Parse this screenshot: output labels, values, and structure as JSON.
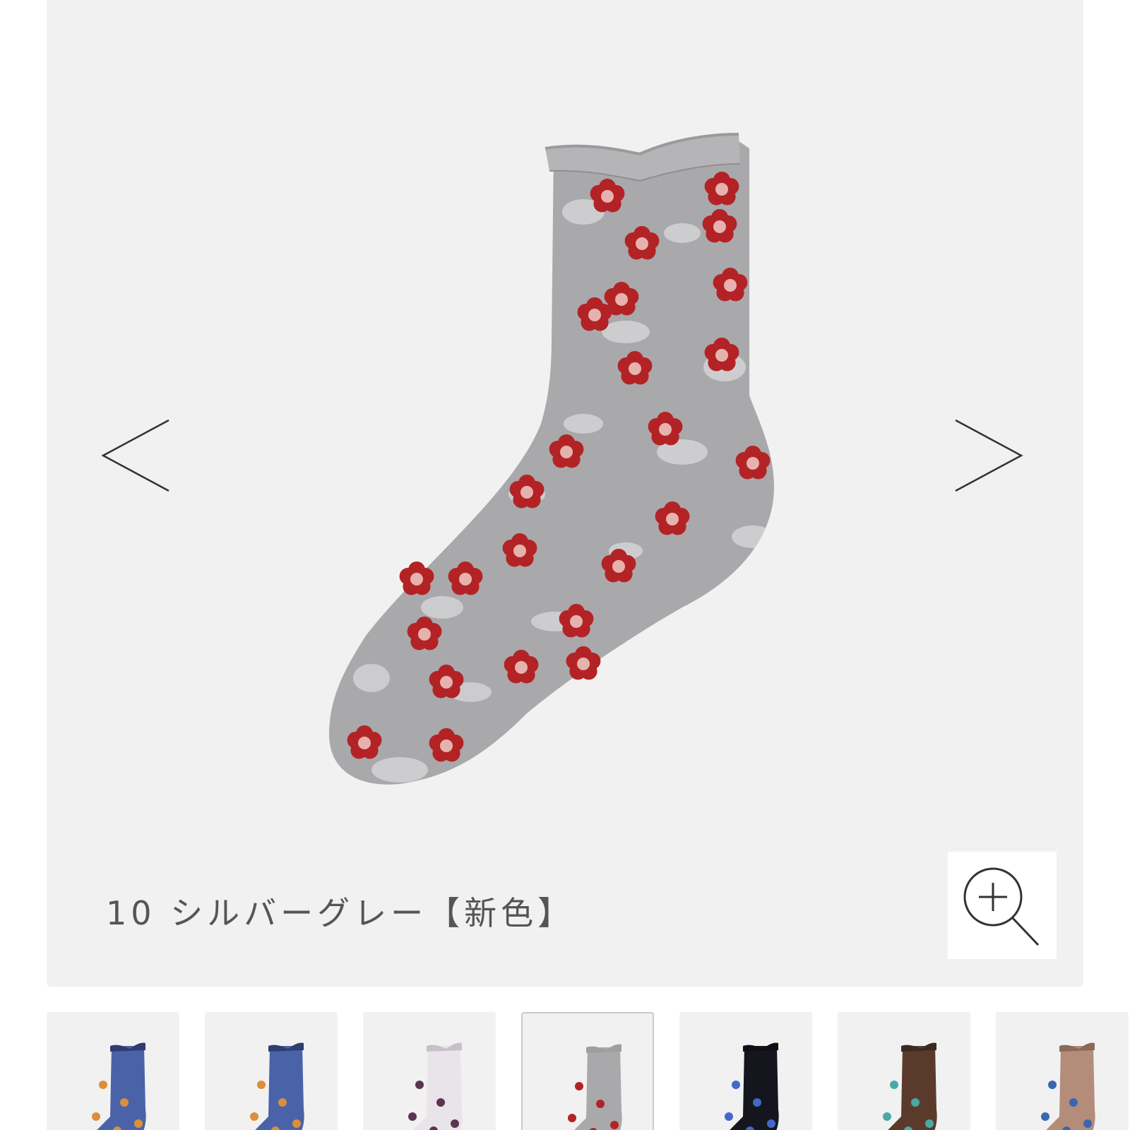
{
  "viewer": {
    "caption": "10 シルバーグレー【新色】"
  },
  "colors": {
    "background": "#f1f1f1",
    "sock_gray": "#a9a9ab",
    "flower_red": "#b32326",
    "caption_text": "#555555"
  },
  "icons": {
    "prev": "chevron-left-icon",
    "next": "chevron-right-icon",
    "zoom": "zoom-in-icon"
  },
  "thumbnails": [
    {
      "base": "#4a63a8",
      "flower": "#d98f3c",
      "cuff": "#2f3c6e",
      "active": false
    },
    {
      "base": "#4a63a8",
      "flower": "#d98f3c",
      "cuff": "#2f3c6e",
      "active": false
    },
    {
      "base": "#e9e4ea",
      "flower": "#5b3550",
      "cuff": "#c8c0c8",
      "active": false
    },
    {
      "base": "#a9a9ab",
      "flower": "#b32326",
      "cuff": "#9e9ea0",
      "active": true
    },
    {
      "base": "#15161d",
      "flower": "#4468c8",
      "cuff": "#0e0f14",
      "active": false
    },
    {
      "base": "#5a3b2b",
      "flower": "#49a8a8",
      "cuff": "#3c2a20",
      "active": false
    },
    {
      "base": "#b48c7a",
      "flower": "#3a66b0",
      "cuff": "#8c6a5a",
      "active": false
    }
  ]
}
